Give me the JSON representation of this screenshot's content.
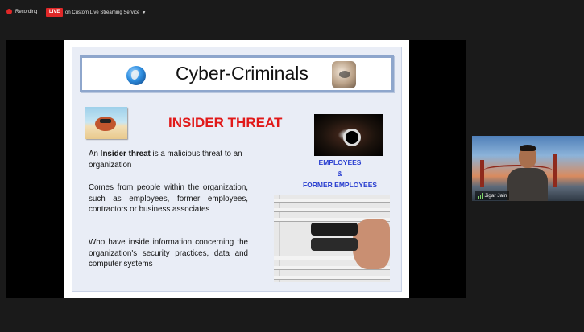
{
  "topbar": {
    "recording_label": "Recording",
    "live_label": "LIVE",
    "stream_label": "on Custom Live Streaming Service"
  },
  "slide": {
    "title": "Cyber-Criminals",
    "heading": "INSIDER THREAT",
    "para1_prefix": "An ",
    "para1_cursor_text": "I",
    "para1_bold": "nsider threat",
    "para1_suffix": " is a malicious threat to an organization",
    "para2": "Comes from people within the organization, such as employees, former employees, contractors or business associates",
    "para3": "Who have inside information concerning the organization's security practices, data and computer systems",
    "emp_line1": "EMPLOYEES",
    "emp_line2": "&",
    "emp_line3": "FORMER EMPLOYEES"
  },
  "participant": {
    "name": "Jigar Jain"
  },
  "colors": {
    "background": "#1a1a1a",
    "live": "#e02828",
    "heading": "#e11919",
    "employees": "#2a3fd0",
    "title_border": "#8ea6cc"
  },
  "icons": [
    "record-dot-icon",
    "chevron-down-icon",
    "globe-icon",
    "hand-icon",
    "signal-icon"
  ]
}
